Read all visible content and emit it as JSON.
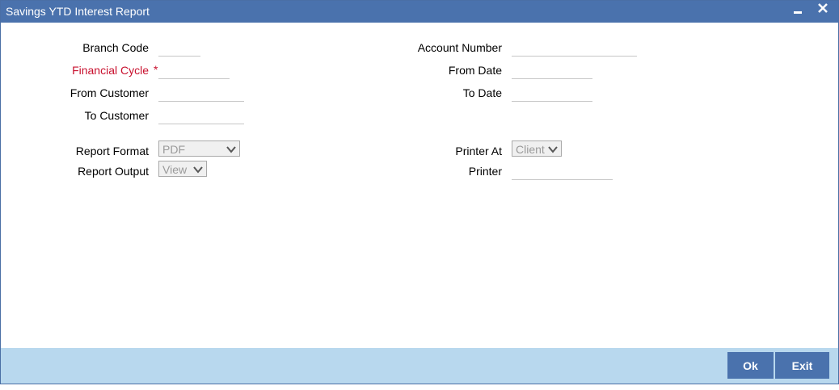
{
  "window": {
    "title": "Savings YTD Interest Report"
  },
  "form": {
    "branch_code": {
      "label": "Branch Code",
      "value": ""
    },
    "financial_cycle": {
      "label": "Financial Cycle",
      "required_mark": "*",
      "value": ""
    },
    "from_customer": {
      "label": "From Customer",
      "value": ""
    },
    "to_customer": {
      "label": "To Customer",
      "value": ""
    },
    "account_number": {
      "label": "Account Number",
      "value": ""
    },
    "from_date": {
      "label": "From Date",
      "value": ""
    },
    "to_date": {
      "label": "To Date",
      "value": ""
    },
    "report_format": {
      "label": "Report Format",
      "selected": "PDF"
    },
    "report_output": {
      "label": "Report Output",
      "selected": "View"
    },
    "printer_at": {
      "label": "Printer At",
      "selected": "Client"
    },
    "printer": {
      "label": "Printer",
      "value": ""
    }
  },
  "footer": {
    "ok_label": "Ok",
    "exit_label": "Exit"
  },
  "colors": {
    "titlebar": "#4a72ad",
    "required_label": "#c8102e",
    "footer_bar": "#b8d8ee",
    "button": "#4a72ad"
  }
}
